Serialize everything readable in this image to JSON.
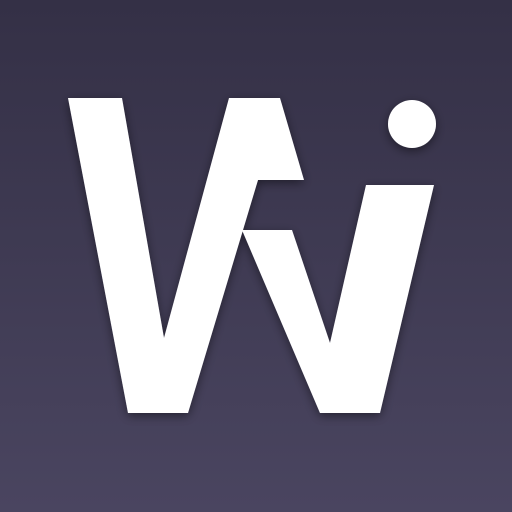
{
  "app_icon": {
    "logo_text": "Vvi",
    "logo_color": "#ffffff",
    "background_top": "#343046",
    "background_bottom": "#4a4560"
  }
}
